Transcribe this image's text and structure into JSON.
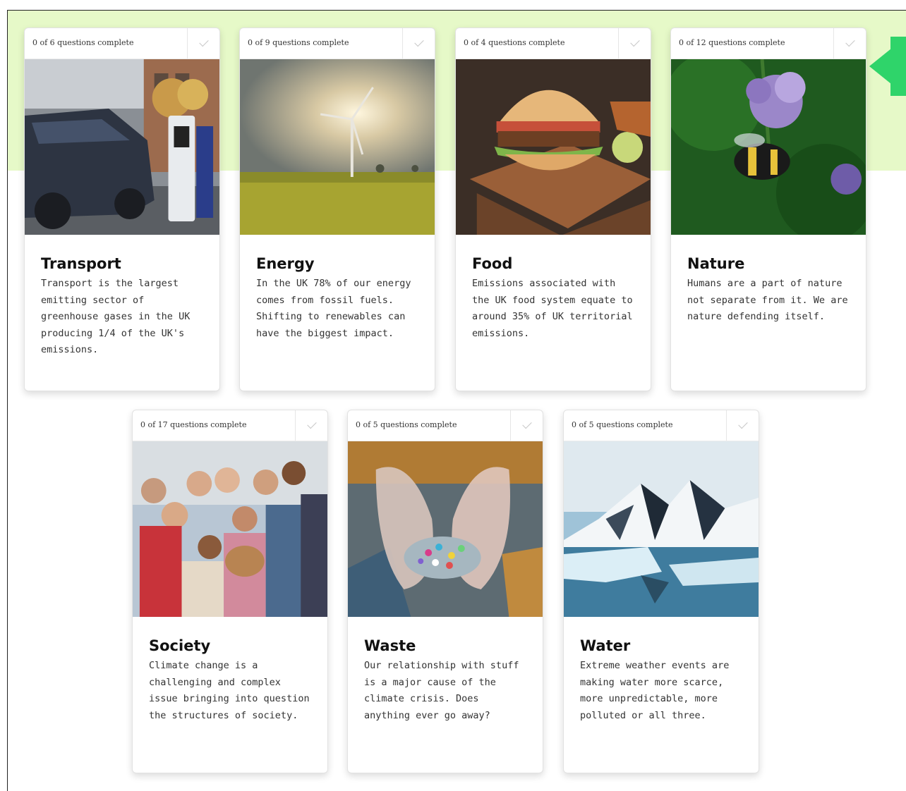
{
  "colors": {
    "band": "#e6f9c8",
    "accent_green": "#2fd46a"
  },
  "cards": [
    {
      "progress": "0 of 6 questions complete",
      "title": "Transport",
      "description": "Transport is the largest emitting sector of greenhouse gases in the UK producing 1/4 of the UK's emissions.",
      "image": "electric-car-charging-photo"
    },
    {
      "progress": "0 of 9 questions complete",
      "title": "Energy",
      "description": "In the UK 78% of our energy comes from fossil fuels. Shifting to renewables can have the biggest impact.",
      "image": "wind-turbine-photo"
    },
    {
      "progress": "0 of 4 questions complete",
      "title": "Food",
      "description": "Emissions associated with the UK food system equate to around 35% of UK territorial emissions.",
      "image": "burger-photo"
    },
    {
      "progress": "0 of 12 questions complete",
      "title": "Nature",
      "description": "Humans are a part of nature not separate from it. We are nature defending itself.",
      "image": "bumblebee-photo"
    },
    {
      "progress": "0 of 17 questions complete",
      "title": "Society",
      "description": "Climate change is a challenging and complex issue bringing into question the structures of society.",
      "image": "people-group-photo"
    },
    {
      "progress": "0 of 5 questions complete",
      "title": "Waste",
      "description": "Our relationship with stuff is a major cause of the climate crisis. Does anything ever go away?",
      "image": "microplastics-hands-photo"
    },
    {
      "progress": "0 of 5 questions complete",
      "title": "Water",
      "description": "Extreme weather events are making water more scarce, more unpredictable, more polluted or all three.",
      "image": "icy-mountains-lake-photo"
    }
  ]
}
